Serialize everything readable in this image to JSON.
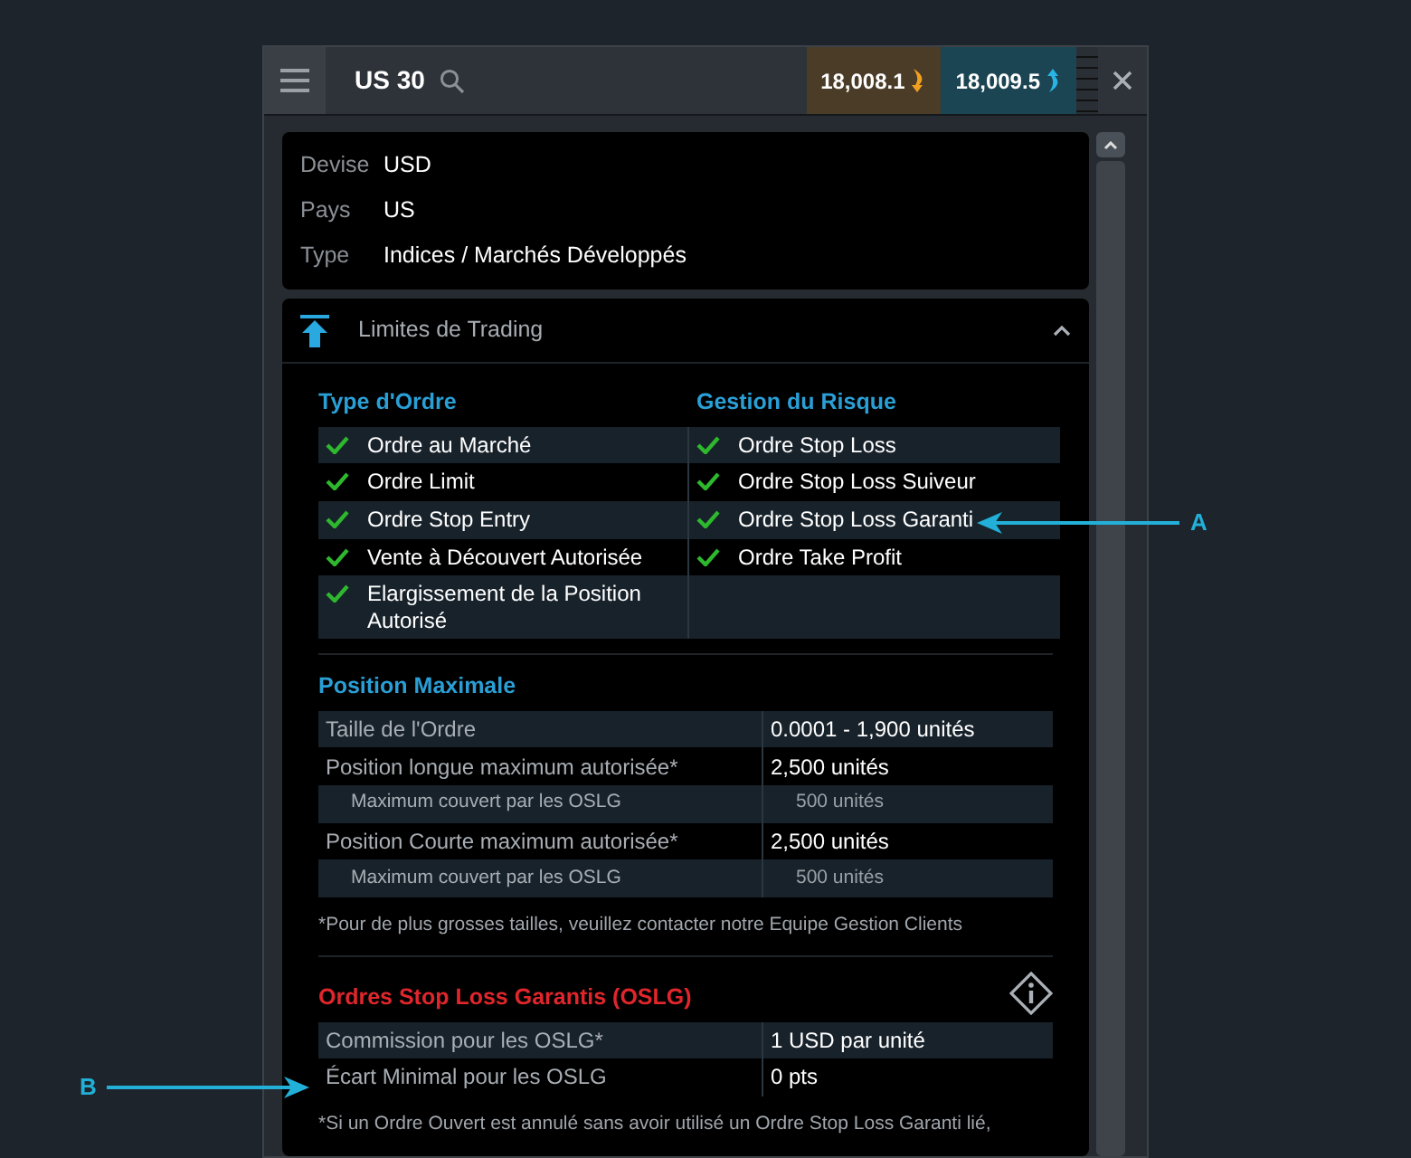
{
  "header": {
    "title": "US 30",
    "sell_price": "18,008.1",
    "buy_price": "18,009.5"
  },
  "info": [
    {
      "label": "Devise",
      "value": "USD"
    },
    {
      "label": "Pays",
      "value": "US"
    },
    {
      "label": "Type",
      "value": "Indices / Marchés Développés"
    }
  ],
  "trading_limits": {
    "title": "Limites de Trading",
    "expanded": true,
    "order_types": {
      "heading": "Type d'Ordre",
      "items": [
        {
          "label": "Ordre au Marché",
          "checked": true
        },
        {
          "label": "Ordre Limit",
          "checked": true
        },
        {
          "label": "Ordre Stop Entry",
          "checked": true
        },
        {
          "label": "Vente à Découvert Autorisée",
          "checked": true
        },
        {
          "label": "Elargissement de la Position Autorisé",
          "checked": true
        }
      ]
    },
    "risk_management": {
      "heading": "Gestion du Risque",
      "items": [
        {
          "label": "Ordre Stop Loss",
          "checked": true
        },
        {
          "label": "Ordre Stop Loss Suiveur",
          "checked": true
        },
        {
          "label": "Ordre Stop Loss Garanti",
          "checked": true
        },
        {
          "label": "Ordre Take Profit",
          "checked": true
        }
      ]
    },
    "max_position": {
      "heading": "Position Maximale",
      "rows": [
        {
          "kind": "main",
          "label": "Taille de l'Ordre",
          "value": "0.0001 - 1,900 unités"
        },
        {
          "kind": "main",
          "label": "Position longue maximum autorisée*",
          "value": "2,500 unités"
        },
        {
          "kind": "sub",
          "label": "Maximum couvert par les OSLG",
          "value": "500 unités"
        },
        {
          "kind": "main",
          "label": "Position Courte maximum autorisée*",
          "value": "2,500 unités"
        },
        {
          "kind": "sub",
          "label": "Maximum couvert par les OSLG",
          "value": "500 unités"
        }
      ],
      "footnote": "*Pour de plus grosses tailles, veuillez contacter notre Equipe Gestion Clients"
    },
    "gslo": {
      "heading": "Ordres Stop Loss Garantis (OSLG)",
      "rows": [
        {
          "label": "Commission pour les OSLG*",
          "value": "1 USD par unité"
        },
        {
          "label": "Écart Minimal pour les OSLG",
          "value": "0 pts"
        }
      ],
      "footnote": "*Si un Ordre Ouvert est annulé sans avoir utilisé un Ordre Stop Loss Garanti lié,"
    }
  },
  "annotations": [
    {
      "label": "A"
    },
    {
      "label": "B"
    }
  ]
}
